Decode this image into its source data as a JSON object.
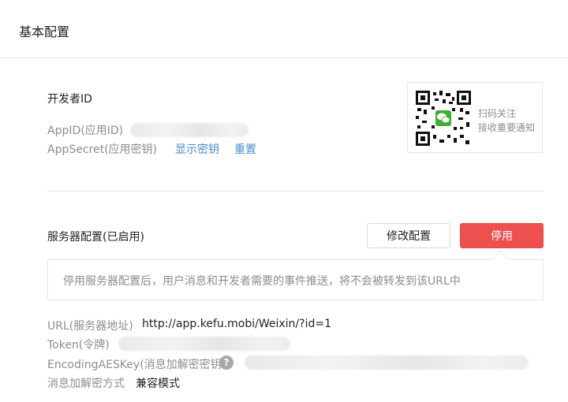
{
  "header": {
    "title": "基本配置"
  },
  "developer": {
    "heading": "开发者ID",
    "appid_label": "AppID(应用ID)",
    "appsecret_label": "AppSecret(应用密钥)",
    "show_secret_link": "显示密钥",
    "reset_link": "重置"
  },
  "qr": {
    "line1": "扫码关注",
    "line2": "接收重要通知"
  },
  "server": {
    "heading": "服务器配置(已启用)",
    "modify_button": "修改配置",
    "disable_button": "停用",
    "notice": "停用服务器配置后，用户消息和开发者需要的事件推送，将不会被转发到该URL中",
    "url_label": "URL(服务器地址)",
    "url_value": "http://app.kefu.mobi/Weixin/?id=1",
    "token_label": "Token(令牌)",
    "aes_label": "EncodingAESKey(消息加解密密钥",
    "aes_help": "?",
    "mode_label": "消息加解密方式",
    "mode_value": "兼容模式"
  },
  "colors": {
    "accent_link": "#4a8bd2",
    "danger_button": "#ee5050"
  }
}
